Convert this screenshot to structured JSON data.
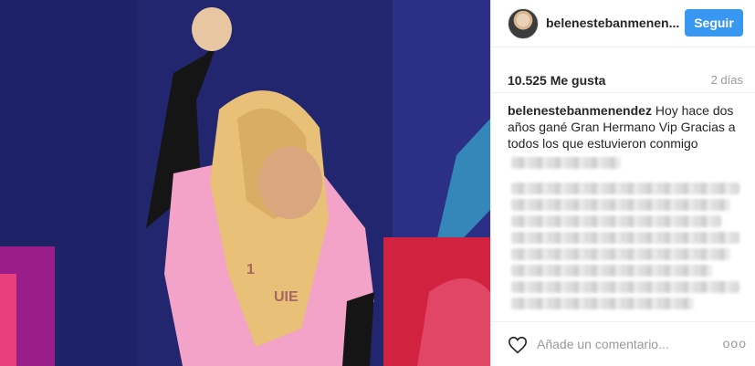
{
  "post": {
    "username": "belenestebanmenendez",
    "username_short": "belenestebanmenen...",
    "follow_label": "Seguir",
    "likes": "10.525 Me gusta",
    "time": "2 días",
    "caption_text": "Hoy hace dos años gané Gran Hermano Vip Gracias a todos los que estuvieron conmigo",
    "comment_placeholder": "Añade un comentario...",
    "more_label": "ooo"
  },
  "colors": {
    "accent": "#3897f0",
    "text": "#262626",
    "muted": "#999999",
    "shirt_pink": "#f4a7c9"
  },
  "icons": {
    "like": "heart-outline-icon",
    "more": "more-options-icon"
  }
}
